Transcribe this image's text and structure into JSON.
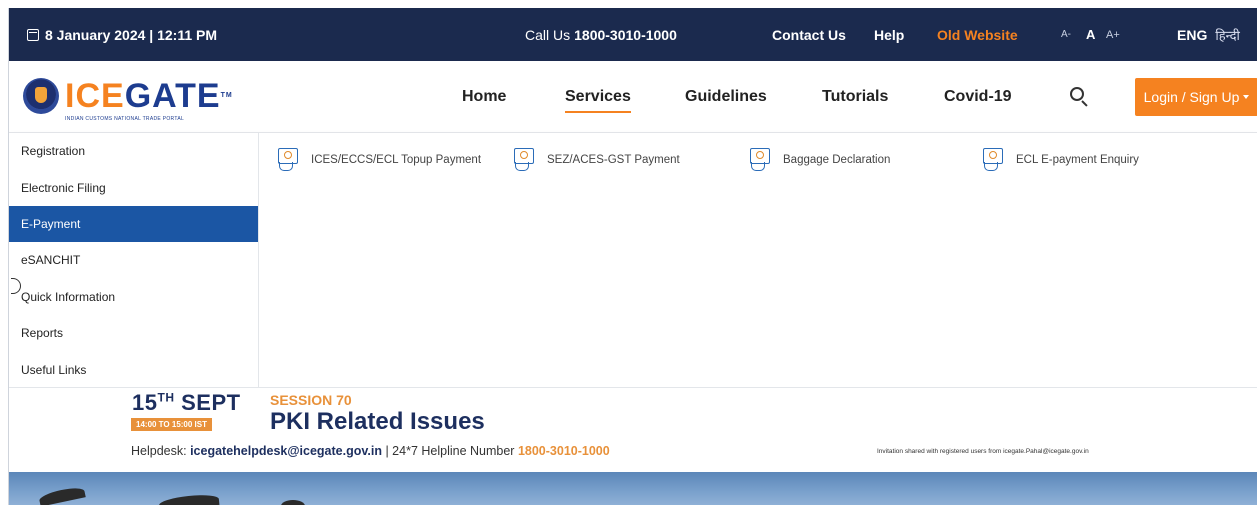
{
  "topbar": {
    "datetime": "8 January 2024 | 12:11 PM",
    "call_label": "Call Us",
    "call_number": "1800-3010-1000",
    "contact": "Contact Us",
    "help": "Help",
    "old_website": "Old Website",
    "font_small": "A-",
    "font_normal": "A",
    "font_large": "A+",
    "lang_eng": "ENG",
    "lang_hindi": "हिन्दी"
  },
  "logo": {
    "brand_part1": "ICE",
    "brand_part2": "GATE",
    "tm": "TM",
    "tagline": "INDIAN CUSTOMS NATIONAL TRADE PORTAL"
  },
  "nav": {
    "items": [
      {
        "label": "Home"
      },
      {
        "label": "Services",
        "active": true
      },
      {
        "label": "Guidelines"
      },
      {
        "label": "Tutorials"
      },
      {
        "label": "Covid-19"
      }
    ],
    "login": "Login / Sign Up"
  },
  "services_menu": {
    "items": [
      {
        "label": "Registration"
      },
      {
        "label": "Electronic Filing"
      },
      {
        "label": "E-Payment",
        "active": true
      },
      {
        "label": "eSANCHIT"
      },
      {
        "label": "Quick Information"
      },
      {
        "label": "Reports"
      },
      {
        "label": "Useful Links"
      }
    ],
    "subitems": [
      {
        "label": "ICES/ECCS/ECL Topup Payment",
        "icon": "payment-icon"
      },
      {
        "label": "SEZ/ACES-GST Payment",
        "icon": "payment-icon"
      },
      {
        "label": "Baggage Declaration",
        "icon": "payment-icon"
      },
      {
        "label": "ECL E-payment Enquiry",
        "icon": "payment-icon"
      }
    ]
  },
  "banner": {
    "date_day": "15",
    "date_sup": "TH",
    "date_month": "SEPT",
    "time": "14:00 TO 15:00 IST",
    "session": "SESSION 70",
    "title": "PKI Related Issues",
    "helpdesk_label": "Helpdesk:",
    "helpdesk_email": "icegatehelpdesk@icegate.gov.in",
    "helpline_label": "| 24*7 Helpline Number",
    "helpline_number": "1800-3010-1000",
    "invitation": "Invitation shared with registered users from icegate.Pahal@icegate.gov.in"
  },
  "colors": {
    "topbar_bg": "#1b2a4e",
    "accent_orange": "#f58220",
    "active_menu": "#1b56a4"
  }
}
